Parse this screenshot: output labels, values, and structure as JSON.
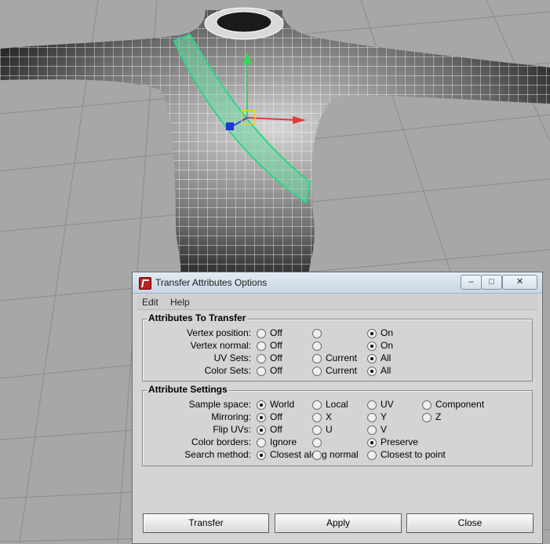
{
  "window": {
    "title": "Transfer Attributes Options"
  },
  "menu": [
    "Edit",
    "Help"
  ],
  "sections": [
    {
      "title": "Attributes To Transfer",
      "rows": [
        {
          "label": "Vertex position:",
          "options": [
            "Off",
            "",
            "On"
          ],
          "selected": 2
        },
        {
          "label": "Vertex normal:",
          "options": [
            "Off",
            "",
            "On"
          ],
          "selected": 2
        },
        {
          "label": "UV Sets:",
          "options": [
            "Off",
            "Current",
            "All"
          ],
          "selected": 2
        },
        {
          "label": "Color Sets:",
          "options": [
            "Off",
            "Current",
            "All"
          ],
          "selected": 2
        }
      ]
    },
    {
      "title": "Attribute Settings",
      "rows": [
        {
          "label": "Sample space:",
          "options": [
            "World",
            "Local",
            "UV",
            "Component"
          ],
          "selected": 0
        },
        {
          "label": "Mirroring:",
          "options": [
            "Off",
            "X",
            "Y",
            "Z"
          ],
          "selected": 0
        },
        {
          "label": "Flip UVs:",
          "options": [
            "Off",
            "U",
            "V"
          ],
          "selected": 0
        },
        {
          "label": "Color borders:",
          "options": [
            "Ignore",
            "",
            "Preserve"
          ],
          "selected": 2
        },
        {
          "label": "Search method:",
          "options": [
            "Closest along normal",
            "",
            "Closest to point"
          ],
          "selected": 0
        }
      ]
    }
  ],
  "buttons": {
    "transfer": "Transfer",
    "apply": "Apply",
    "close": "Close"
  }
}
